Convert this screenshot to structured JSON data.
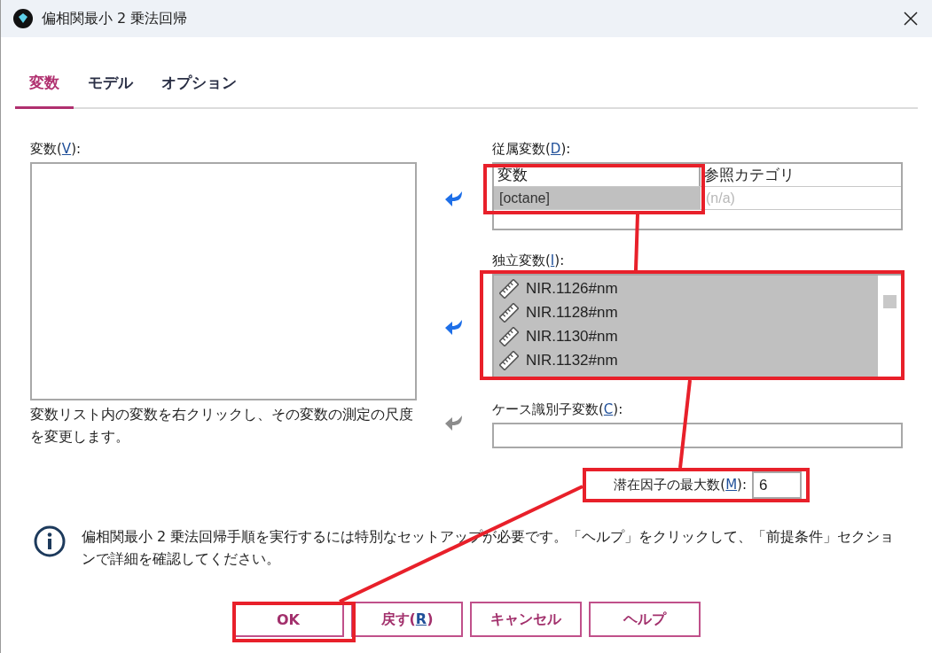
{
  "window": {
    "title": "偏相関最小 2 乗法回帰"
  },
  "tabs": [
    {
      "label": "変数",
      "selected": true
    },
    {
      "label": "モデル",
      "selected": false
    },
    {
      "label": "オプション",
      "selected": false
    }
  ],
  "variables": {
    "label": {
      "before": "変数(",
      "key": "V",
      "after": "):"
    },
    "note": "変数リスト内の変数を右クリックし、その変数の測定の尺度を変更します。"
  },
  "dependent": {
    "label": {
      "before": "従属変数(",
      "key": "D",
      "after": "):"
    },
    "move_enabled": true,
    "columns": [
      "変数",
      "参照カテゴリ"
    ],
    "rows": [
      {
        "variable": "[octane]",
        "reference": "(n/a)",
        "selected": true
      }
    ]
  },
  "independent": {
    "label": {
      "before": "独立変数(",
      "key": "I",
      "after": "):"
    },
    "move_enabled": true,
    "items": [
      {
        "name": "NIR.1126#nm",
        "selected": true
      },
      {
        "name": "NIR.1128#nm",
        "selected": true
      },
      {
        "name": "NIR.1130#nm",
        "selected": true
      },
      {
        "name": "NIR.1132#nm",
        "selected": true
      }
    ]
  },
  "case_id": {
    "label": {
      "before": "ケース識別子変数(",
      "key": "C",
      "after": "):"
    },
    "move_enabled": false
  },
  "max_factors": {
    "label": {
      "before": "潜在因子の最大数(",
      "key": "M",
      "after": "):"
    },
    "value": "6"
  },
  "info": "偏相関最小 2 乗法回帰手順を実行するには特別なセットアップが必要です。「ヘルプ」をクリックして、「前提条件」セクションで詳細を確認してください。",
  "buttons": [
    {
      "before": "OK"
    },
    {
      "before": "戻す(",
      "key": "R",
      "after": ")"
    },
    {
      "before": "キャンセル"
    },
    {
      "before": "ヘルプ"
    }
  ]
}
